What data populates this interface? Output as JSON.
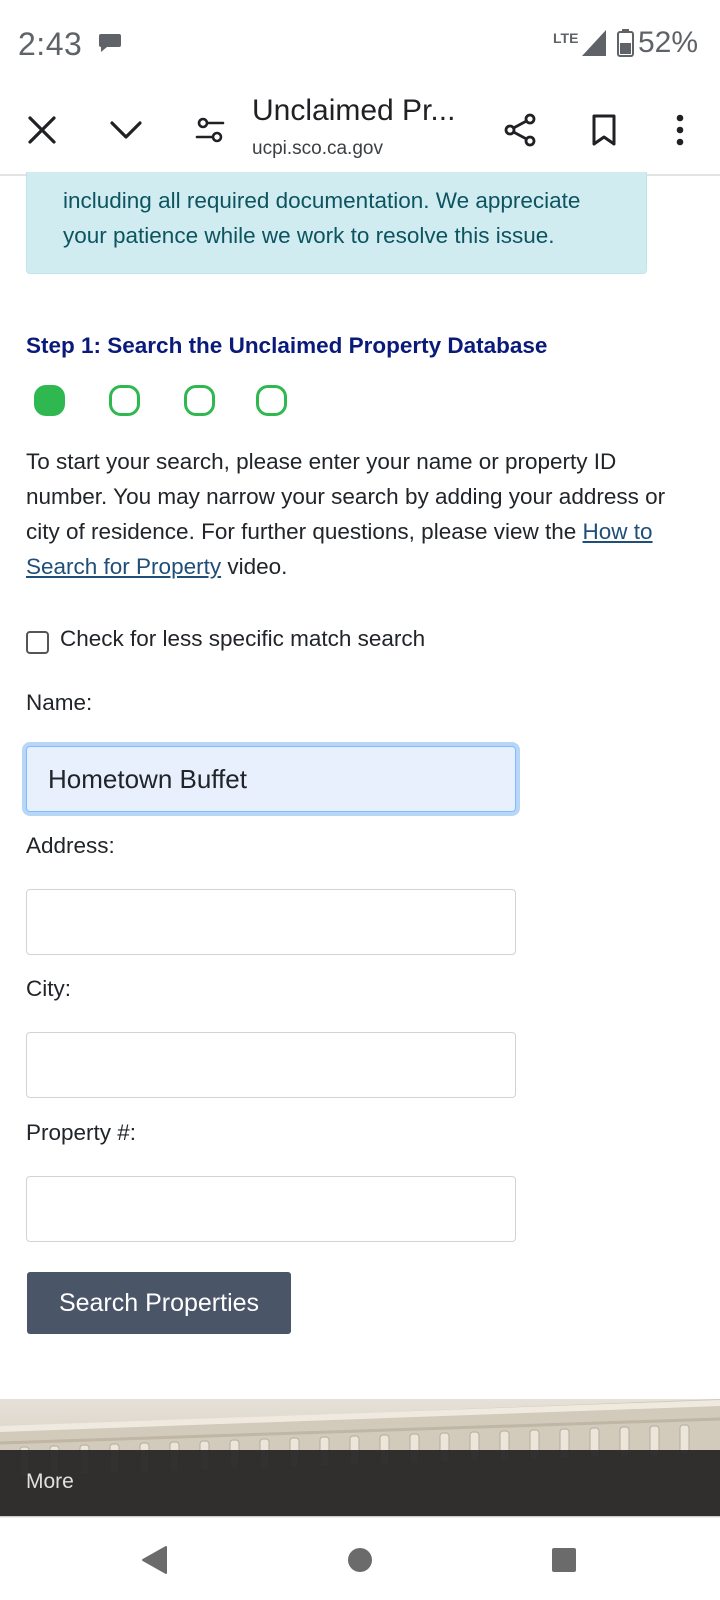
{
  "status_bar": {
    "time": "2:43",
    "network": "LTE",
    "battery": "52%"
  },
  "browser": {
    "title": "Unclaimed Pr...",
    "url": "ucpi.sco.ca.gov"
  },
  "alert": {
    "line1": "including all required documentation. We appreciate",
    "line2": "your patience while we work to resolve this issue."
  },
  "step": {
    "title": "Step 1: Search the Unclaimed Property Database",
    "current": 1,
    "total": 4
  },
  "intro": {
    "text_before": "To start your search, please enter your name or property ID number. You may narrow your search by adding your address or city of residence. For further questions, please view the ",
    "link": "How to Search for Property",
    "text_after": " video."
  },
  "options": {
    "less_specific_label": "Check for less specific match search",
    "less_specific_checked": false
  },
  "form": {
    "name_label": "Name:",
    "name_value": "Hometown Buffet",
    "address_label": "Address:",
    "address_value": "",
    "city_label": "City:",
    "city_value": "",
    "property_label": "Property #:",
    "property_value": ""
  },
  "search_button": "Search Properties",
  "footer": {
    "more_label": "More"
  },
  "colors": {
    "alert_bg": "#d1ecf1",
    "alert_text": "#0c5460",
    "step_title": "#0a1a7a",
    "progress": "#2fb84f",
    "link": "#1f4e79",
    "button": "#4a5568",
    "focus_bg": "#e8f0fe"
  }
}
